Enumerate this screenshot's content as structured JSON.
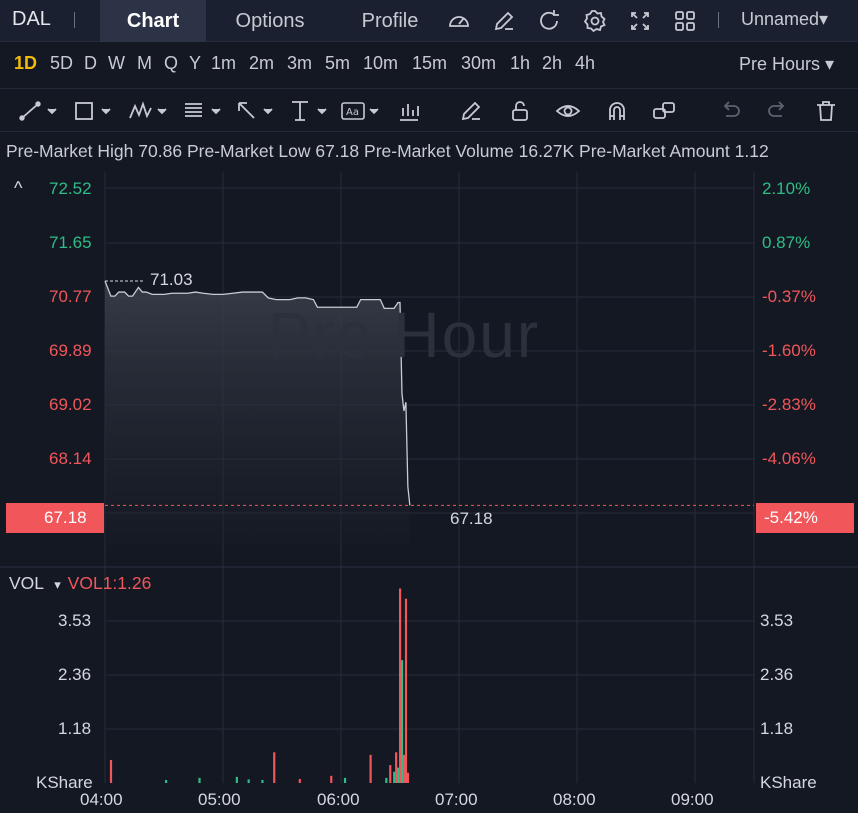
{
  "header": {
    "symbol": "DAL",
    "tabs": [
      {
        "label": "Chart",
        "active": true
      },
      {
        "label": "Options",
        "active": false
      },
      {
        "label": "Profile",
        "active": false
      }
    ],
    "icons": [
      "gauge-icon",
      "edit-icon",
      "refresh-icon",
      "gear-icon",
      "fullscreen-icon",
      "grid-layout-icon"
    ],
    "layout_name": "Unnamed",
    "layout_caret": "▾"
  },
  "timeframes": {
    "items": [
      "1D",
      "5D",
      "D",
      "W",
      "M",
      "Q",
      "Y",
      "1m",
      "2m",
      "3m",
      "5m",
      "10m",
      "15m",
      "30m",
      "1h",
      "2h",
      "4h"
    ],
    "active": "1D",
    "session_label": "Pre Hours",
    "session_caret": "▾"
  },
  "tools": [
    "trend-line-icon",
    "rectangle-icon",
    "pattern-icon",
    "fib-icon",
    "arrow-icon",
    "measure-icon",
    "text-icon",
    "indicator-icon",
    "pencil-icon",
    "lock-icon",
    "eye-icon",
    "magnet-icon",
    "link-icon",
    "undo-icon",
    "redo-icon",
    "trash-icon"
  ],
  "info": {
    "high_label": "Pre-Market High",
    "high_value": "70.86",
    "low_label": "Pre-Market Low",
    "low_value": "67.18",
    "volume_label": "Pre-Market Volume",
    "volume_value": "16.27K",
    "amount_label": "Pre-Market Amount",
    "amount_value": "1.12"
  },
  "chart": {
    "watermark": "Pre Hour",
    "collapse_icon": "^",
    "left_ticks": [
      "72.52",
      "71.65",
      "70.77",
      "69.89",
      "69.02",
      "68.14"
    ],
    "right_ticks": [
      "2.10%",
      "0.87%",
      "-0.37%",
      "-1.60%",
      "-2.83%",
      "-4.06%"
    ],
    "current_price": "67.18",
    "current_pct": "-5.42%",
    "high_marker": "71.03",
    "last_label": "67.18",
    "x_ticks": [
      "04:00",
      "05:00",
      "06:00",
      "07:00",
      "08:00",
      "09:00"
    ],
    "volume": {
      "label": "VOL",
      "caret": "▾",
      "indicator": "VOL1:1.26",
      "ticks": [
        "3.53",
        "2.36",
        "1.18"
      ],
      "unit": "KShare"
    },
    "colors": {
      "up": "#2ebd85",
      "down": "#f0565a",
      "line": "#c8cbd2",
      "grid": "#262b38"
    }
  },
  "chart_data": {
    "type": "line",
    "x_range": [
      "04:00",
      "09:40"
    ],
    "ylim": [
      66.5,
      72.9
    ],
    "grid": true,
    "price": {
      "x": [
        "04:00",
        "04:03",
        "04:05",
        "04:07",
        "04:10",
        "04:12",
        "04:14",
        "04:17",
        "04:19",
        "04:21",
        "04:24",
        "04:27",
        "04:30",
        "04:34",
        "04:38",
        "04:42",
        "04:46",
        "04:50",
        "04:55",
        "05:00",
        "05:05",
        "05:10",
        "05:14",
        "05:17",
        "05:20",
        "05:23",
        "05:27",
        "05:30",
        "05:34",
        "05:38",
        "05:42",
        "05:46",
        "05:48",
        "05:51",
        "05:55",
        "05:59",
        "06:03",
        "06:06",
        "06:08",
        "06:10",
        "06:12",
        "06:14",
        "06:16",
        "06:18",
        "06:20",
        "06:22",
        "06:24",
        "06:27",
        "06:29",
        "06:30",
        "06:31",
        "06:32",
        "06:33",
        "06:34",
        "06:35"
      ],
      "y": [
        71.03,
        70.77,
        70.77,
        70.84,
        70.84,
        70.77,
        70.77,
        70.92,
        70.84,
        70.84,
        70.8,
        70.8,
        70.8,
        70.82,
        70.82,
        70.82,
        70.84,
        70.82,
        70.8,
        70.8,
        70.82,
        70.84,
        70.84,
        70.84,
        70.84,
        70.74,
        70.71,
        70.71,
        70.71,
        70.74,
        70.74,
        70.71,
        70.58,
        70.58,
        70.58,
        70.58,
        70.58,
        70.58,
        70.58,
        70.71,
        70.71,
        70.71,
        70.71,
        70.71,
        70.71,
        70.56,
        70.56,
        70.56,
        70.66,
        70.66,
        69.1,
        68.8,
        68.95,
        67.5,
        67.18
      ]
    },
    "volume": {
      "x": [
        "04:03",
        "04:31",
        "04:48",
        "05:07",
        "05:13",
        "05:20",
        "05:26",
        "05:39",
        "05:55",
        "06:02",
        "06:15",
        "06:23",
        "06:25",
        "06:27",
        "06:28",
        "06:29",
        "06:30",
        "06:31",
        "06:32",
        "06:33",
        "06:34"
      ],
      "values": [
        0.45,
        0.06,
        0.1,
        0.12,
        0.07,
        0.06,
        0.6,
        0.08,
        0.14,
        0.1,
        0.55,
        0.1,
        0.35,
        0.22,
        0.6,
        0.3,
        3.8,
        2.4,
        0.55,
        3.6,
        0.2
      ],
      "direction": [
        "down",
        "up",
        "up",
        "up",
        "up",
        "up",
        "down",
        "down",
        "down",
        "up",
        "down",
        "up",
        "down",
        "up",
        "down",
        "up",
        "down",
        "up",
        "down",
        "down",
        "down"
      ],
      "ylim": [
        0,
        4.2
      ]
    }
  }
}
